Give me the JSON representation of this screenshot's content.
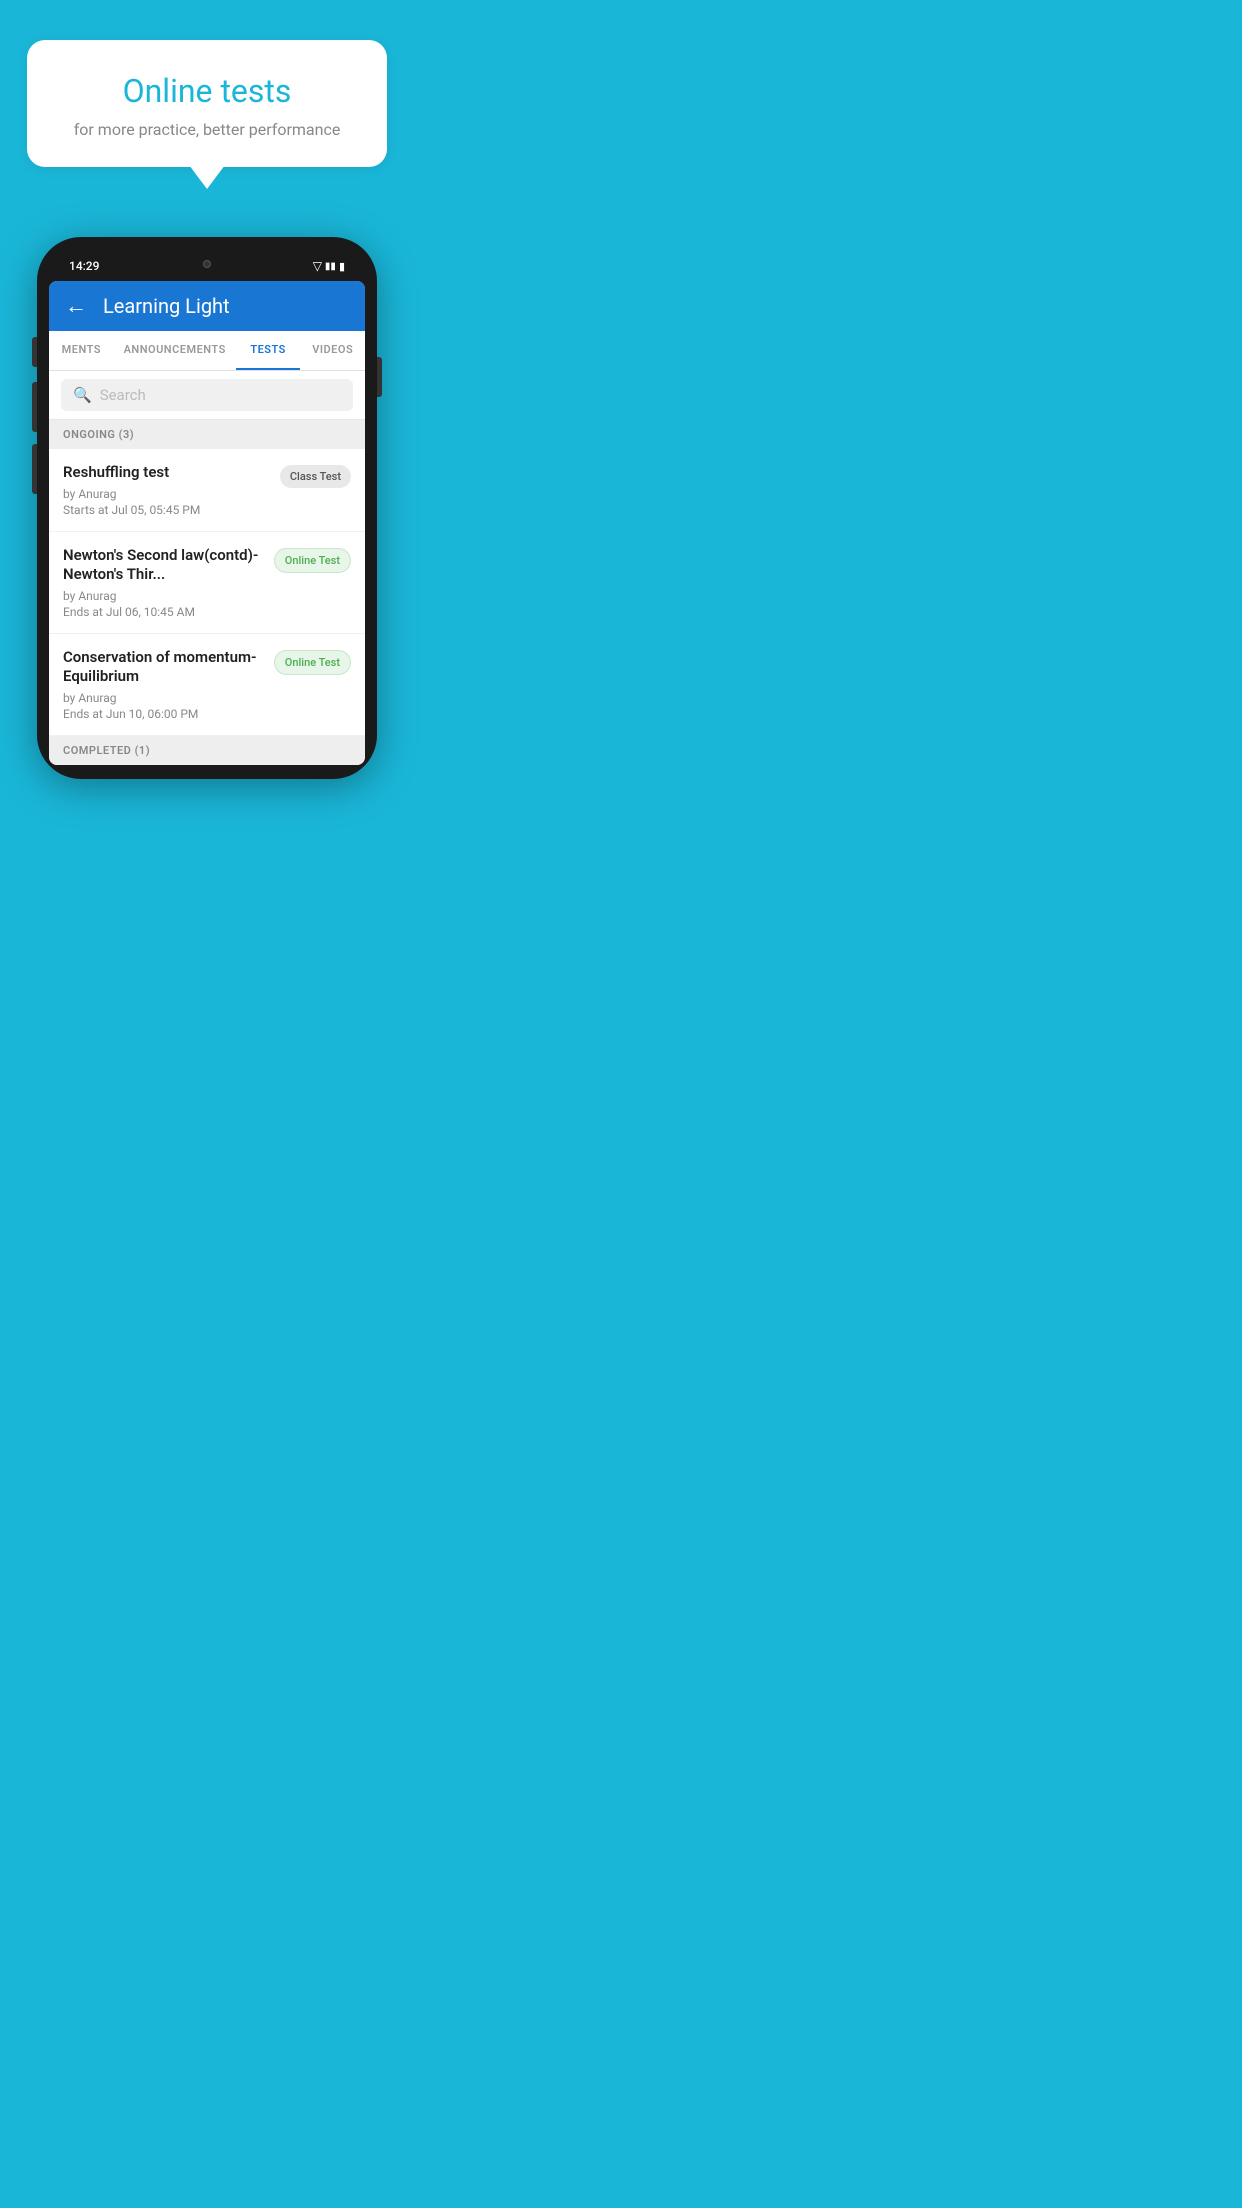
{
  "background_color": "#1ab6d8",
  "promo": {
    "title": "Online tests",
    "subtitle": "for more practice, better performance"
  },
  "phone": {
    "time": "14:29",
    "app_bar": {
      "title": "Learning Light",
      "back_label": "←"
    },
    "tabs": [
      {
        "label": "MENTS",
        "active": false
      },
      {
        "label": "ANNOUNCEMENTS",
        "active": false
      },
      {
        "label": "TESTS",
        "active": true
      },
      {
        "label": "VIDEOS",
        "active": false
      }
    ],
    "search": {
      "placeholder": "Search"
    },
    "sections": [
      {
        "header": "ONGOING (3)",
        "tests": [
          {
            "title": "Reshuffling test",
            "author": "by Anurag",
            "time_label": "Starts at",
            "time": "Jul 05, 05:45 PM",
            "badge": "Class Test",
            "badge_type": "class"
          },
          {
            "title": "Newton's Second law(contd)-Newton's Thir...",
            "author": "by Anurag",
            "time_label": "Ends at",
            "time": "Jul 06, 10:45 AM",
            "badge": "Online Test",
            "badge_type": "online"
          },
          {
            "title": "Conservation of momentum-Equilibrium",
            "author": "by Anurag",
            "time_label": "Ends at",
            "time": "Jun 10, 06:00 PM",
            "badge": "Online Test",
            "badge_type": "online"
          }
        ]
      }
    ],
    "completed_header": "COMPLETED (1)"
  }
}
